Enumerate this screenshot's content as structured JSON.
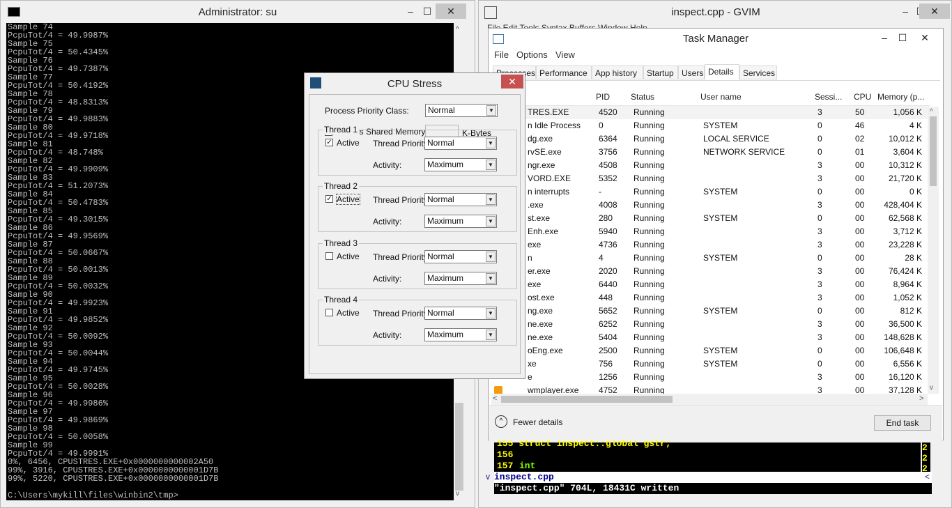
{
  "console": {
    "title": "Administrator: su",
    "min": "–",
    "max": "☐",
    "close": "✕",
    "lines": [
      "Sample 74",
      "PcpuTot/4 = 49.9987%",
      "Sample 75",
      "PcpuTot/4 = 50.4345%",
      "Sample 76",
      "PcpuTot/4 = 49.7387%",
      "Sample 77",
      "PcpuTot/4 = 50.4192%",
      "Sample 78",
      "PcpuTot/4 = 48.8313%",
      "Sample 79",
      "PcpuTot/4 = 49.9883%",
      "Sample 80",
      "PcpuTot/4 = 49.9718%",
      "Sample 81",
      "PcpuTot/4 = 48.748%",
      "Sample 82",
      "PcpuTot/4 = 49.9909%",
      "Sample 83",
      "PcpuTot/4 = 51.2073%",
      "Sample 84",
      "PcpuTot/4 = 50.4783%",
      "Sample 85",
      "PcpuTot/4 = 49.3015%",
      "Sample 86",
      "PcpuTot/4 = 49.9569%",
      "Sample 87",
      "PcpuTot/4 = 50.0667%",
      "Sample 88",
      "PcpuTot/4 = 50.0013%",
      "Sample 89",
      "PcpuTot/4 = 50.0032%",
      "Sample 90",
      "PcpuTot/4 = 49.9923%",
      "Sample 91",
      "PcpuTot/4 = 49.9852%",
      "Sample 92",
      "PcpuTot/4 = 50.0092%",
      "Sample 93",
      "PcpuTot/4 = 50.0044%",
      "Sample 94",
      "PcpuTot/4 = 49.9745%",
      "Sample 95",
      "PcpuTot/4 = 50.0028%",
      "Sample 96",
      "PcpuTot/4 = 49.9986%",
      "Sample 97",
      "PcpuTot/4 = 49.9869%",
      "Sample 98",
      "PcpuTot/4 = 50.0058%",
      "Sample 99",
      "PcpuTot/4 = 49.9991%",
      "0%, 6456, CPUSTRES.EXE+0x0000000000002A50",
      "99%, 3916, CPUSTRES.EXE+0x0000000000001D7B",
      "99%, 5220, CPUSTRES.EXE+0x0000000000001D7B",
      "",
      "C:\\Users\\mykill\\files\\winbin2\\tmp>"
    ]
  },
  "gvim": {
    "title": "inspect.cpp                    - GVIM",
    "menu_partial": "File  Edit  Tools  Syntax  Buffers  Window  Help",
    "line1": "155 struct inspect::global gstr;",
    "line2_num": "156",
    "line3_num": "157",
    "line3_kw": "int",
    "right_col": [
      "2",
      "2",
      "2"
    ],
    "status": "inspect.cpp",
    "message": "\"inspect.cpp\" 704L, 18431C written"
  },
  "taskmanager": {
    "title": "Task Manager",
    "menu": [
      "File",
      "Options",
      "View"
    ],
    "tabs": [
      "Processes",
      "Performance",
      "App history",
      "Startup",
      "Users",
      "Details",
      "Services"
    ],
    "active_tab": "Details",
    "headers": [
      "PID",
      "Status",
      "User name",
      "Sessi...",
      "CPU",
      "Memory (p..."
    ],
    "rows": [
      {
        "name": "TRES.EXE",
        "pid": "4520",
        "status": "Running",
        "user": "",
        "session": "3",
        "cpu": "50",
        "mem": "1,056 K"
      },
      {
        "name": "n Idle Process",
        "pid": "0",
        "status": "Running",
        "user": "SYSTEM",
        "session": "0",
        "cpu": "46",
        "mem": "4 K"
      },
      {
        "name": "dg.exe",
        "pid": "6364",
        "status": "Running",
        "user": "LOCAL SERVICE",
        "session": "0",
        "cpu": "02",
        "mem": "10,012 K"
      },
      {
        "name": "rvSE.exe",
        "pid": "3756",
        "status": "Running",
        "user": "NETWORK SERVICE",
        "session": "0",
        "cpu": "01",
        "mem": "3,604 K"
      },
      {
        "name": "ngr.exe",
        "pid": "4508",
        "status": "Running",
        "user": "",
        "session": "3",
        "cpu": "00",
        "mem": "10,312 K"
      },
      {
        "name": "VORD.EXE",
        "pid": "5352",
        "status": "Running",
        "user": "",
        "session": "3",
        "cpu": "00",
        "mem": "21,720 K"
      },
      {
        "name": "n interrupts",
        "pid": "-",
        "status": "Running",
        "user": "SYSTEM",
        "session": "0",
        "cpu": "00",
        "mem": "0 K"
      },
      {
        "name": ".exe",
        "pid": "4008",
        "status": "Running",
        "user": "",
        "session": "3",
        "cpu": "00",
        "mem": "428,404 K"
      },
      {
        "name": "st.exe",
        "pid": "280",
        "status": "Running",
        "user": "SYSTEM",
        "session": "0",
        "cpu": "00",
        "mem": "62,568 K"
      },
      {
        "name": "Enh.exe",
        "pid": "5940",
        "status": "Running",
        "user": "",
        "session": "3",
        "cpu": "00",
        "mem": "3,712 K"
      },
      {
        "name": "exe",
        "pid": "4736",
        "status": "Running",
        "user": "",
        "session": "3",
        "cpu": "00",
        "mem": "23,228 K"
      },
      {
        "name": "n",
        "pid": "4",
        "status": "Running",
        "user": "SYSTEM",
        "session": "0",
        "cpu": "00",
        "mem": "28 K"
      },
      {
        "name": "er.exe",
        "pid": "2020",
        "status": "Running",
        "user": "",
        "session": "3",
        "cpu": "00",
        "mem": "76,424 K"
      },
      {
        "name": "exe",
        "pid": "6440",
        "status": "Running",
        "user": "",
        "session": "3",
        "cpu": "00",
        "mem": "8,964 K"
      },
      {
        "name": "ost.exe",
        "pid": "448",
        "status": "Running",
        "user": "",
        "session": "3",
        "cpu": "00",
        "mem": "1,052 K"
      },
      {
        "name": "ng.exe",
        "pid": "5652",
        "status": "Running",
        "user": "SYSTEM",
        "session": "0",
        "cpu": "00",
        "mem": "812 K"
      },
      {
        "name": "ne.exe",
        "pid": "6252",
        "status": "Running",
        "user": "",
        "session": "3",
        "cpu": "00",
        "mem": "36,500 K"
      },
      {
        "name": "ne.exe",
        "pid": "5404",
        "status": "Running",
        "user": "",
        "session": "3",
        "cpu": "00",
        "mem": "148,628 K"
      },
      {
        "name": "oEng.exe",
        "pid": "2500",
        "status": "Running",
        "user": "SYSTEM",
        "session": "0",
        "cpu": "00",
        "mem": "106,648 K"
      },
      {
        "name": "xe",
        "pid": "756",
        "status": "Running",
        "user": "SYSTEM",
        "session": "0",
        "cpu": "00",
        "mem": "6,556 K"
      },
      {
        "name": "e",
        "pid": "1256",
        "status": "Running",
        "user": "",
        "session": "3",
        "cpu": "00",
        "mem": "16,120 K"
      },
      {
        "name": "wmplayer.exe",
        "pid": "4752",
        "status": "Running",
        "user": "",
        "session": "3",
        "cpu": "00",
        "mem": "37,128 K"
      }
    ],
    "fewer_details": "Fewer details",
    "end_task": "End task"
  },
  "cpustress": {
    "title": "CPU Stress",
    "close": "✕",
    "priority_label": "Process Priority Class:",
    "priority_value": "Normal",
    "shared_label": "Access Shared Memory",
    "kbytes_label": "K-Bytes",
    "threads": [
      {
        "label": "Thread 1",
        "active_label": "Active",
        "active": true,
        "priority_label": "Thread Priority:",
        "priority": "Normal",
        "activity_label": "Activity:",
        "activity": "Maximum"
      },
      {
        "label": "Thread 2",
        "active_label": "Active",
        "active": true,
        "priority_label": "Thread Priority:",
        "priority": "Normal",
        "activity_label": "Activity:",
        "activity": "Maximum"
      },
      {
        "label": "Thread 3",
        "active_label": "Active",
        "active": false,
        "priority_label": "Thread Priority:",
        "priority": "Normal",
        "activity_label": "Activity:",
        "activity": "Maximum"
      },
      {
        "label": "Thread 4",
        "active_label": "Active",
        "active": false,
        "priority_label": "Thread Priority:",
        "priority": "Normal",
        "activity_label": "Activity:",
        "activity": "Maximum"
      }
    ]
  }
}
